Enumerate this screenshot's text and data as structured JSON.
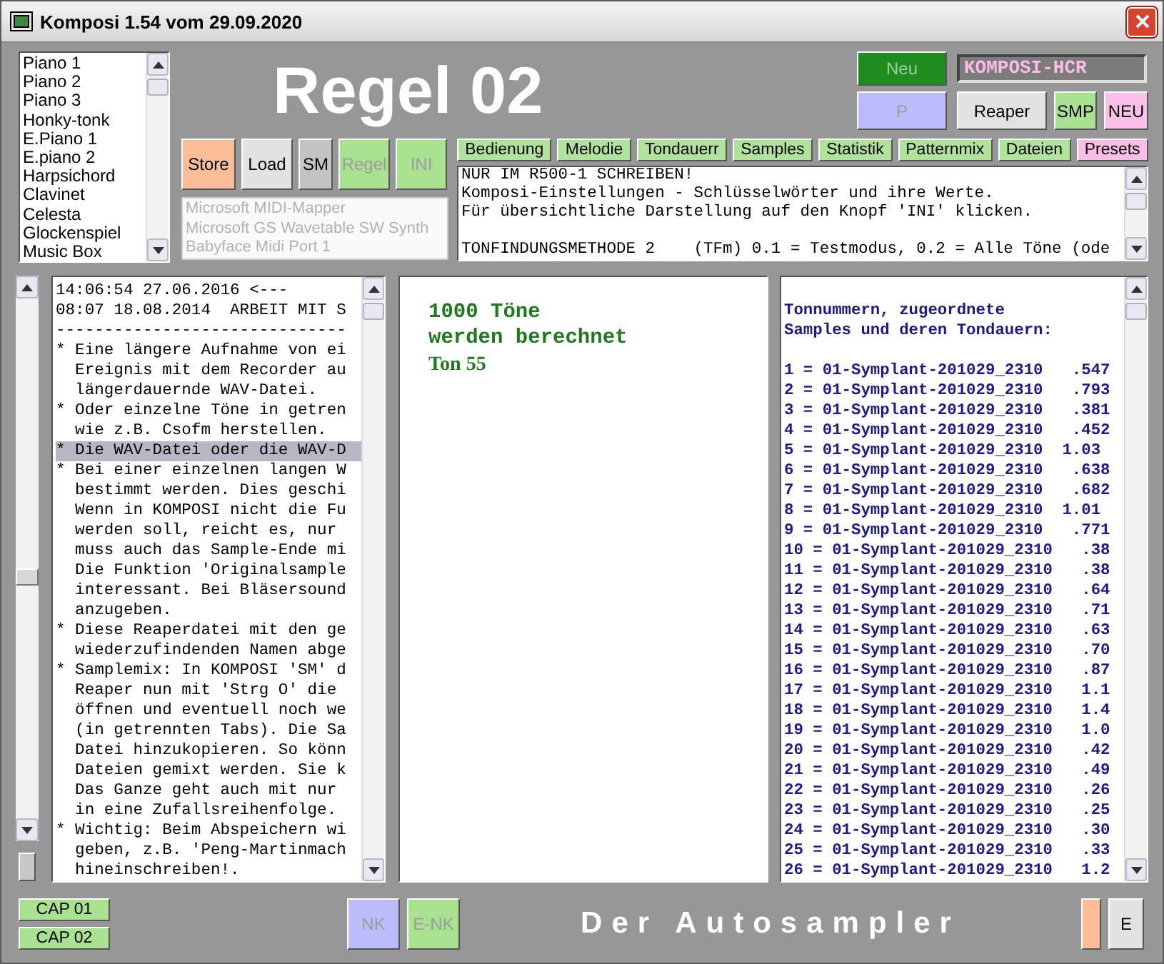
{
  "window": {
    "title": "Komposi 1.54 vom 29.09.2020"
  },
  "instrument_list": {
    "items": [
      "Piano 1",
      "Piano 2",
      "Piano 3",
      "Honky-tonk",
      "E.Piano 1",
      "E.piano 2",
      "Harpsichord",
      "Clavinet",
      "Celesta",
      "Glockenspiel",
      "Music Box"
    ]
  },
  "heading": "Regel 02",
  "top_buttons": [
    {
      "label": "Neu",
      "color": "#1f8c1f",
      "disabled": true
    },
    {
      "label": "P",
      "color": "#bcbcfa",
      "disabled": true
    },
    {
      "label": "Reaper",
      "color": "#e2e2e2",
      "disabled": false
    },
    {
      "label": "SMP",
      "color": "#a8e291",
      "disabled": false
    },
    {
      "label": "NEU",
      "color": "#fcbfe8",
      "disabled": false
    }
  ],
  "profile_field": {
    "value": "KOMPOSI-HCR"
  },
  "action_buttons": [
    {
      "label": "Store",
      "color": "#fbbd98",
      "disabled": false
    },
    {
      "label": "Load",
      "color": "#e2e2e2",
      "disabled": false
    },
    {
      "label": "SM",
      "color": "#c4c4c4",
      "disabled": false
    },
    {
      "label": "Regel",
      "color": "#a8e291",
      "disabled": true
    },
    {
      "label": "INI",
      "color": "#a8e291",
      "disabled": true
    }
  ],
  "midi_ports": {
    "disabled": true,
    "items": [
      "Microsoft MIDI-Mapper",
      "Microsoft GS Wavetable SW Synth",
      "Babyface Midi Port 1"
    ]
  },
  "section_buttons": [
    {
      "label": "Bedienung",
      "color": "#b0e39a"
    },
    {
      "label": "Melodie",
      "color": "#b0e39a"
    },
    {
      "label": "Tondauerr",
      "color": "#b0e39a"
    },
    {
      "label": "Samples",
      "color": "#b0e39a"
    },
    {
      "label": "Statistik",
      "color": "#b0e39a"
    },
    {
      "label": "Patternmix",
      "color": "#b0e39a"
    },
    {
      "label": "Dateien",
      "color": "#b0e39a"
    },
    {
      "label": "Presets",
      "color": "#fbbde6"
    }
  ],
  "info_text": {
    "lines": [
      "NUR IM R500-1 SCHREIBEN!",
      "Komposi-Einstellungen - Schlüsselwörter und ihre Werte.",
      "Für übersichtliche Darstellung auf den Knopf 'INI' klicken."
    ],
    "setting_lines": [
      "TONFINDUNGSMETHODE 2    (TFm) 0.1 = Testmodus, 0.2 = Alle Töne (ode"
    ]
  },
  "log_panel": {
    "lines": [
      {
        "text": "14:06:54 27.06.2016 <---",
        "selected": false
      },
      {
        "text": "08:07 18.08.2014  ARBEIT MIT S",
        "selected": false
      },
      {
        "text": "------------------------------",
        "selected": false
      },
      {
        "text": "* Eine längere Aufnahme von ei",
        "selected": false
      },
      {
        "text": "  Ereignis mit dem Recorder au",
        "selected": false
      },
      {
        "text": "  längerdauernde WAV-Datei.",
        "selected": false
      },
      {
        "text": "* Oder einzelne Töne in getren",
        "selected": false
      },
      {
        "text": "  wie z.B. Csofm herstellen.",
        "selected": false
      },
      {
        "text": "* Die WAV-Datei oder die WAV-D",
        "selected": true
      },
      {
        "text": "* Bei einer einzelnen langen W",
        "selected": false
      },
      {
        "text": "  bestimmt werden. Dies geschi",
        "selected": false
      },
      {
        "text": "  Wenn in KOMPOSI nicht die Fu",
        "selected": false
      },
      {
        "text": "  werden soll, reicht es, nur",
        "selected": false
      },
      {
        "text": "  muss auch das Sample-Ende mi",
        "selected": false
      },
      {
        "text": "  Die Funktion 'Originalsample",
        "selected": false
      },
      {
        "text": "  interessant. Bei Bläsersound",
        "selected": false
      },
      {
        "text": "  anzugeben.",
        "selected": false
      },
      {
        "text": "* Diese Reaperdatei mit den ge",
        "selected": false
      },
      {
        "text": "  wiederzufindenden Namen abge",
        "selected": false
      },
      {
        "text": "* Samplemix: In KOMPOSI 'SM' d",
        "selected": false
      },
      {
        "text": "  Reaper nun mit 'Strg O' die",
        "selected": false
      },
      {
        "text": "  öffnen und eventuell noch we",
        "selected": false
      },
      {
        "text": "  (in getrennten Tabs). Die Sa",
        "selected": false
      },
      {
        "text": "  Datei hinzukopieren. So könn",
        "selected": false
      },
      {
        "text": "  Dateien gemixt werden. Sie k",
        "selected": false
      },
      {
        "text": "  Das Ganze geht auch mit nur",
        "selected": false
      },
      {
        "text": "  in eine Zufallsreihenfolge.",
        "selected": false
      },
      {
        "text": "* Wichtig: Beim Abspeichern wi",
        "selected": false
      },
      {
        "text": "  geben, z.B. 'Peng-Martinmach",
        "selected": false
      },
      {
        "text": "  hineinschreiben!.",
        "selected": false
      }
    ]
  },
  "progress_panel": {
    "lines": [
      "1000 Töne",
      "werden berechnet"
    ],
    "status": "Ton 55"
  },
  "samples_panel": {
    "heading_lines": [
      "Tonnummern, zugeordnete",
      "Samples und deren Tondauern:"
    ],
    "lines": [
      "1 = 01-Symplant-201029_2310   .547",
      "2 = 01-Symplant-201029_2310   .793",
      "3 = 01-Symplant-201029_2310   .381",
      "4 = 01-Symplant-201029_2310   .452",
      "5 = 01-Symplant-201029_2310  1.03",
      "6 = 01-Symplant-201029_2310   .638",
      "7 = 01-Symplant-201029_2310   .682",
      "8 = 01-Symplant-201029_2310  1.01",
      "9 = 01-Symplant-201029_2310   .771",
      "10 = 01-Symplant-201029_2310   .38",
      "11 = 01-Symplant-201029_2310   .38",
      "12 = 01-Symplant-201029_2310   .64",
      "13 = 01-Symplant-201029_2310   .71",
      "14 = 01-Symplant-201029_2310   .63",
      "15 = 01-Symplant-201029_2310   .70",
      "16 = 01-Symplant-201029_2310   .87",
      "17 = 01-Symplant-201029_2310   1.1",
      "18 = 01-Symplant-201029_2310   1.4",
      "19 = 01-Symplant-201029_2310   1.0",
      "20 = 01-Symplant-201029_2310   .42",
      "21 = 01-Symplant-201029_2310   .49",
      "22 = 01-Symplant-201029_2310   .26",
      "23 = 01-Symplant-201029_2310   .25",
      "24 = 01-Symplant-201029_2310   .30",
      "25 = 01-Symplant-201029_2310   .33",
      "26 = 01-Symplant-201029_2310   1.2"
    ]
  },
  "cap_buttons": [
    {
      "label": "CAP 01",
      "color": "#a8e291"
    },
    {
      "label": "CAP 02",
      "color": "#a8e291"
    }
  ],
  "bottom_buttons": [
    {
      "label": "NK",
      "color": "#bcbcfa",
      "disabled": true
    },
    {
      "label": "E-NK",
      "color": "#a8e291",
      "disabled": true
    }
  ],
  "footer_title": "Der Autosampler",
  "swatch_button": {
    "color": "#fbbd98"
  },
  "e_button": {
    "label": "E"
  }
}
